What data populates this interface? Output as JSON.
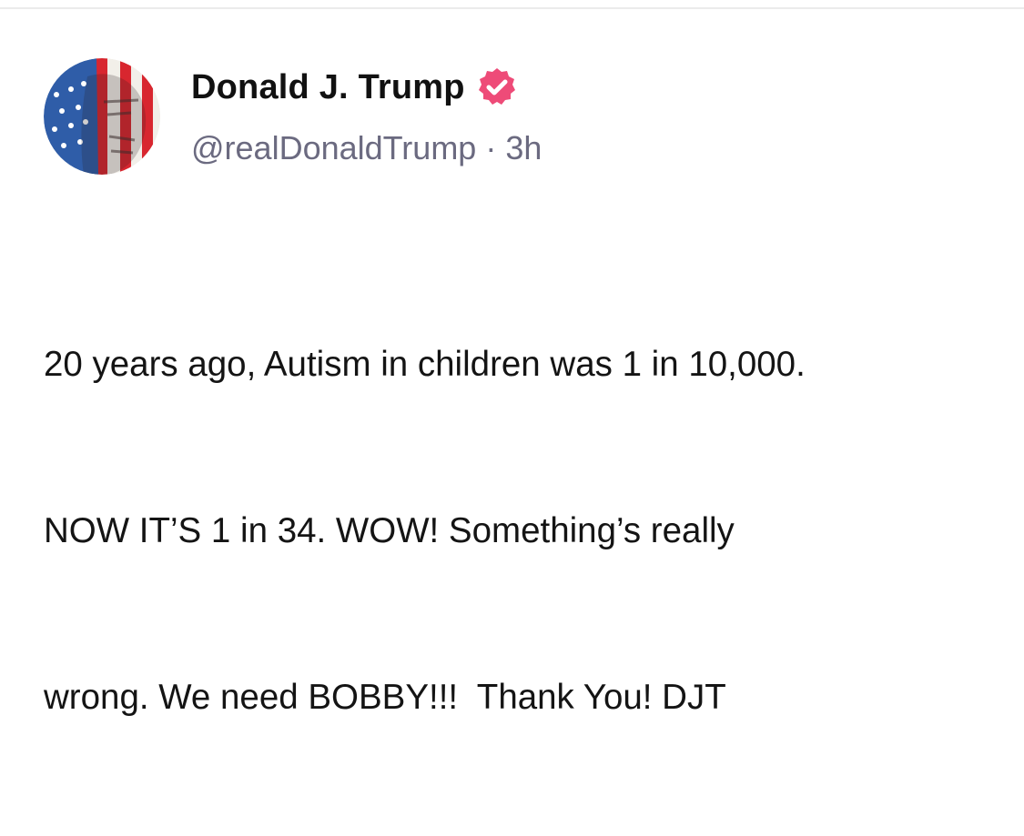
{
  "post": {
    "author": {
      "display_name": "Donald J. Trump",
      "handle": "@realDonaldTrump",
      "verified": true,
      "verified_badge_color": "#ee4b78",
      "avatar_icon": "flag-portrait-avatar"
    },
    "separator": "·",
    "timestamp": "3h",
    "lines": [
      "20 years ago, Autism in children was 1 in 10,000.",
      "NOW IT’S 1 in 34. WOW! Something’s really",
      "wrong. We need BOBBY!!!  Thank You! DJT"
    ]
  },
  "colors": {
    "name": "#111111",
    "meta": "#6b6a80",
    "text": "#141414",
    "divider": "#ebebeb"
  }
}
